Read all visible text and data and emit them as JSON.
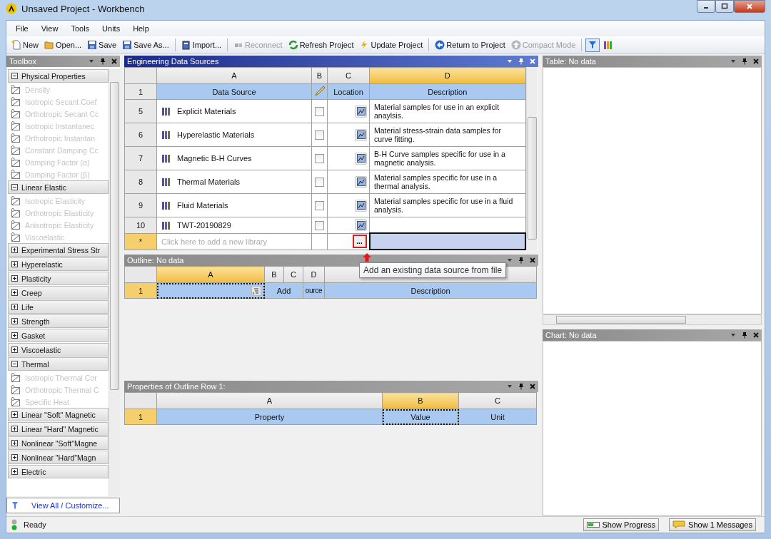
{
  "window": {
    "title": "Unsaved Project - Workbench"
  },
  "menu": [
    "File",
    "View",
    "Tools",
    "Units",
    "Help"
  ],
  "toolbar": {
    "groups": [
      [
        {
          "label": "New",
          "disabled": false
        },
        {
          "label": "Open...",
          "disabled": false
        },
        {
          "label": "Save",
          "disabled": false
        },
        {
          "label": "Save As...",
          "disabled": false
        }
      ],
      [
        {
          "label": "Import...",
          "disabled": false
        }
      ],
      [
        {
          "label": "Reconnect",
          "disabled": true
        },
        {
          "label": "Refresh Project",
          "disabled": false
        },
        {
          "label": "Update Project",
          "disabled": false
        }
      ],
      [
        {
          "label": "Return to Project",
          "disabled": false
        },
        {
          "label": "Compact Mode",
          "disabled": true
        }
      ]
    ],
    "toggles": [
      {
        "selected": true
      },
      {
        "selected": false
      }
    ]
  },
  "toolbox": {
    "title": "Toolbox",
    "active": false,
    "groups": [
      {
        "label": "Physical Properties",
        "expanded": true,
        "items": [
          {
            "label": "Density",
            "disabled": true
          },
          {
            "label": "Isotropic Secant Coef",
            "disabled": true
          },
          {
            "label": "Orthotropic Secant Cc",
            "disabled": true
          },
          {
            "label": "Isotropic Instantanec",
            "disabled": true
          },
          {
            "label": "Orthotropic Instantan",
            "disabled": true
          },
          {
            "label": "Constant Damping Cc",
            "disabled": true
          },
          {
            "label": "Damping Factor (α)",
            "disabled": true
          },
          {
            "label": "Damping Factor (β)",
            "disabled": true
          }
        ]
      },
      {
        "label": "Linear Elastic",
        "expanded": true,
        "items": [
          {
            "label": "Isotropic Elasticity",
            "disabled": true
          },
          {
            "label": "Orthotropic Elasticity",
            "disabled": true
          },
          {
            "label": "Anisotropic Elasticity",
            "disabled": true
          },
          {
            "label": "Viscoelastic",
            "disabled": true
          }
        ]
      },
      {
        "label": "Experimental Stress Str",
        "expanded": false
      },
      {
        "label": "Hyperelastic",
        "expanded": false
      },
      {
        "label": "Plasticity",
        "expanded": false
      },
      {
        "label": "Creep",
        "expanded": false
      },
      {
        "label": "Life",
        "expanded": false
      },
      {
        "label": "Strength",
        "expanded": false
      },
      {
        "label": "Gasket",
        "expanded": false
      },
      {
        "label": "Viscoelastic",
        "expanded": false
      },
      {
        "label": "Thermal",
        "expanded": true,
        "items": [
          {
            "label": "Isotropic Thermal Cor",
            "disabled": true
          },
          {
            "label": "Orthotropic Thermal C",
            "disabled": true
          },
          {
            "label": "Specific Heat",
            "disabled": true
          }
        ]
      },
      {
        "label": "Linear \"Soft\" Magnetic",
        "expanded": false
      },
      {
        "label": "Linear \"Hard\" Magnetic",
        "expanded": false
      },
      {
        "label": "Nonlinear \"Soft\"Magne",
        "expanded": false
      },
      {
        "label": "Nonlinear \"Hard\"Magn",
        "expanded": false
      },
      {
        "label": "Electric",
        "expanded": false
      }
    ],
    "footer_link": "View All / Customize..."
  },
  "sources": {
    "title": "Engineering Data Sources",
    "active": true,
    "columns": [
      {
        "label": "A",
        "selected": false
      },
      {
        "label": "B",
        "selected": false
      },
      {
        "label": "C",
        "selected": false
      },
      {
        "label": "D",
        "selected": true
      }
    ],
    "header": {
      "number": "1",
      "data_source": "Data Source",
      "location": "Location",
      "description": "Description"
    },
    "rows": [
      {
        "number": "5",
        "name": "Explicit Materials",
        "checked": false,
        "description": "Material samples for use in an explicit anaylsis."
      },
      {
        "number": "6",
        "name": "Hyperelastic Materials",
        "checked": false,
        "description": "Material stress-strain data samples for curve fitting."
      },
      {
        "number": "7",
        "name": "Magnetic B-H Curves",
        "checked": false,
        "description": "B-H Curve samples specific for use in a magnetic analysis."
      },
      {
        "number": "8",
        "name": "Thermal Materials",
        "checked": false,
        "description": "Material samples specific for use in a thermal analysis."
      },
      {
        "number": "9",
        "name": "Fluid Materials",
        "checked": false,
        "description": "Material samples specific for use in a fluid analysis."
      },
      {
        "number": "10",
        "name": "TWT-20190829",
        "checked": false
      }
    ],
    "new_row": {
      "marker": "*",
      "selected": true,
      "placeholder": "Click here to add a new library",
      "browse_button": "...",
      "highlighted": true
    }
  },
  "tooltip": "Add an existing data source from file",
  "outline": {
    "title": "Outline: No data",
    "active": false,
    "columns": [
      {
        "label": "A",
        "selected": true
      },
      {
        "label": "B",
        "selected": false
      },
      {
        "label": "C",
        "selected": false
      },
      {
        "label": "D",
        "selected": false
      }
    ],
    "row": {
      "number": "1",
      "selected": true,
      "column_b_c": "Add",
      "column_d": "ource",
      "column_e": "Description"
    }
  },
  "properties": {
    "title": "Properties of Outline Row 1:",
    "active": false,
    "columns": [
      {
        "label": "A",
        "selected": false
      },
      {
        "label": "B",
        "selected": true
      },
      {
        "label": "C",
        "selected": false
      }
    ],
    "row": {
      "number": "1",
      "selected": true,
      "cells": [
        "Property",
        "Value",
        "Unit"
      ]
    }
  },
  "table_panel": {
    "title": "Table: No data",
    "active": false
  },
  "chart_panel": {
    "title": "Chart: No data",
    "active": false
  },
  "status_bar": {
    "text": "Ready",
    "buttons": [
      "Show Progress",
      "Show 1 Messages"
    ]
  }
}
